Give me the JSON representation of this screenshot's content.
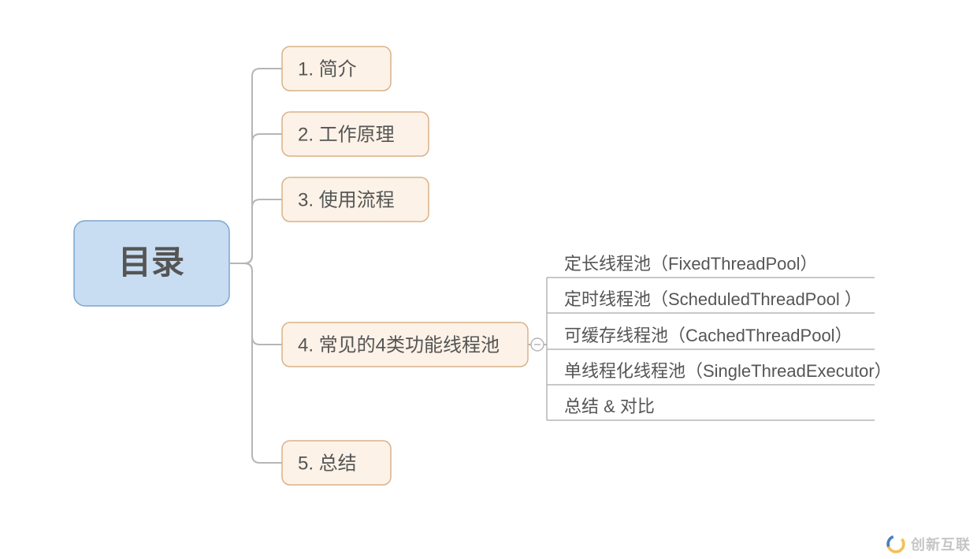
{
  "root": {
    "label": "目录"
  },
  "branches": [
    {
      "label": "1. 简介"
    },
    {
      "label": "2. 工作原理"
    },
    {
      "label": "3. 使用流程"
    },
    {
      "label": "4. 常见的4类功能线程池"
    },
    {
      "label": "5. 总结"
    }
  ],
  "branch4_children": [
    {
      "label": "定长线程池（FixedThreadPool）"
    },
    {
      "label": "定时线程池（ScheduledThreadPool ）"
    },
    {
      "label": "可缓存线程池（CachedThreadPool）"
    },
    {
      "label": "单线程化线程池（SingleThreadExecutor）"
    },
    {
      "label": "总结 & 对比"
    }
  ],
  "watermark": {
    "text": "创新互联"
  },
  "colors": {
    "root_fill": "#c8ddf2",
    "root_stroke": "#7aa6cc",
    "branch_fill": "#fdf2e7",
    "branch_stroke": "#d8b28a",
    "connector": "#b6b6b6",
    "text": "#555555"
  }
}
